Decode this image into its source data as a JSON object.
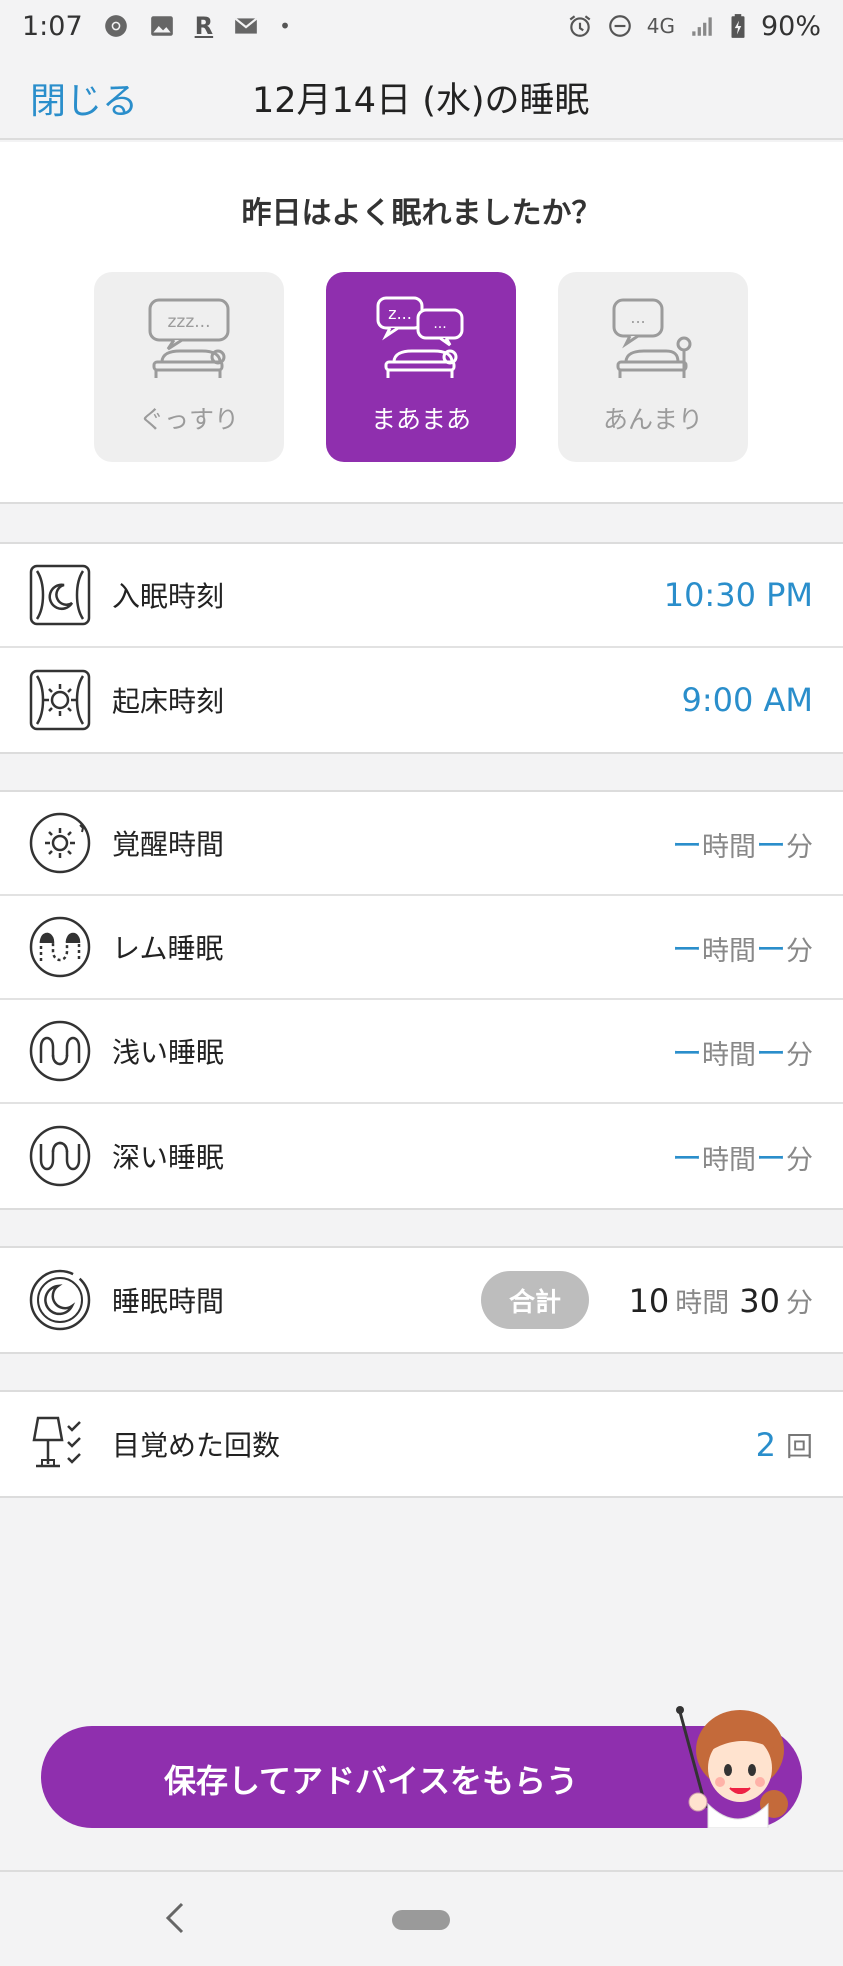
{
  "status_bar": {
    "time": "1:07",
    "signal_type": "4G",
    "battery": "90%",
    "icons": [
      "chrome-icon",
      "image-icon",
      "r-icon",
      "mail-icon",
      "dot",
      "alarm-icon",
      "dnd-icon",
      "signal-icon",
      "battery-icon"
    ],
    "r_label": "R",
    "dot": "•"
  },
  "header": {
    "close_label": "閉じる",
    "title": "12月14日 (水)の睡眠"
  },
  "question": {
    "text": "昨日はよく眠れましたか？",
    "choices": [
      {
        "label": "ぐっすり",
        "selected": false,
        "bubble": "zzz..."
      },
      {
        "label": "まあまあ",
        "selected": true,
        "bubble": "z..."
      },
      {
        "label": "あんまり",
        "selected": false,
        "bubble": "..."
      }
    ]
  },
  "times": {
    "bedtime_label": "入眠時刻",
    "bedtime_value": "10:30 PM",
    "wake_label": "起床時刻",
    "wake_value": "9:00 AM"
  },
  "stages": [
    {
      "label": "覚醒時間",
      "hours": "ー",
      "minutes": "ー"
    },
    {
      "label": "レム睡眠",
      "hours": "ー",
      "minutes": "ー"
    },
    {
      "label": "浅い睡眠",
      "hours": "ー",
      "minutes": "ー"
    },
    {
      "label": "深い睡眠",
      "hours": "ー",
      "minutes": "ー"
    }
  ],
  "units": {
    "hour": "時間",
    "minute": "分",
    "count": "回"
  },
  "total": {
    "label": "睡眠時間",
    "badge": "合計",
    "hours": "10",
    "minutes": "30"
  },
  "awakenings": {
    "label": "目覚めた回数",
    "value": "2"
  },
  "save_button": {
    "label": "保存してアドバイスをもらう"
  },
  "colors": {
    "accent_blue": "#2a8ecb",
    "purple": "#8f2fae",
    "background": "#f3f3f4"
  }
}
